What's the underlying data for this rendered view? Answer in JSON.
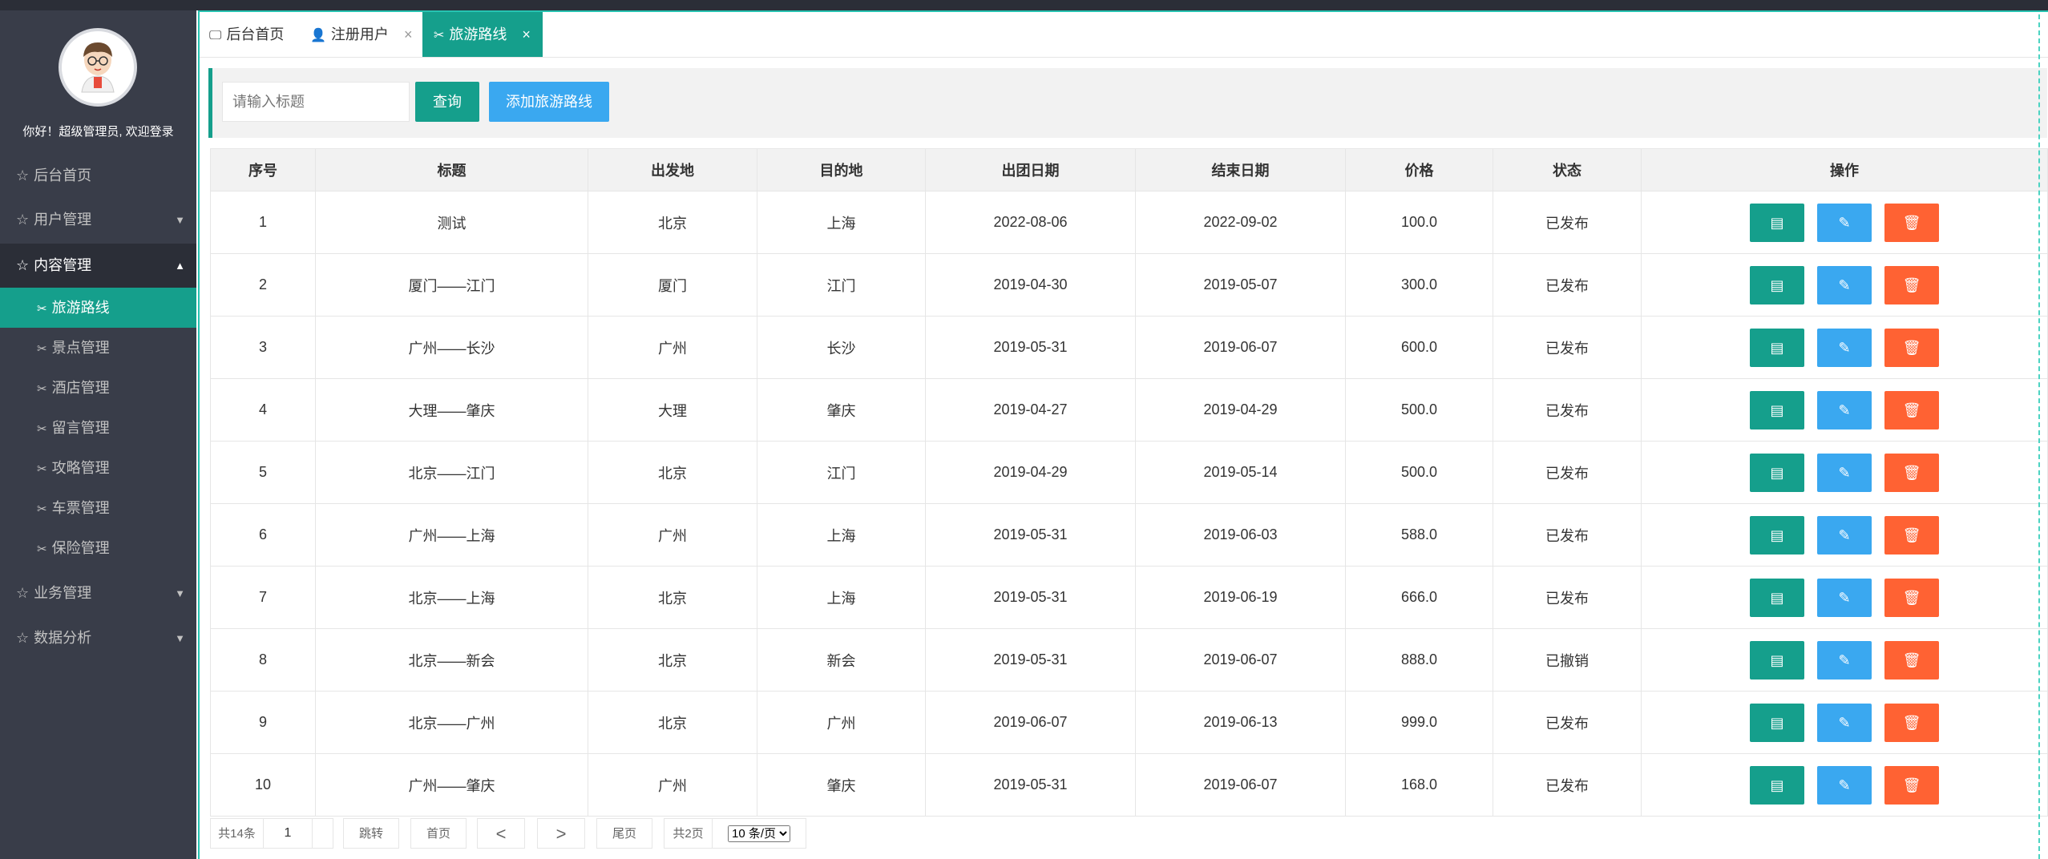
{
  "sidebar": {
    "welcome": "你好！超级管理员, 欢迎登录",
    "menu": [
      {
        "label": "后台首页"
      },
      {
        "label": "用户管理"
      },
      {
        "label": "内容管理"
      },
      {
        "label": "业务管理"
      },
      {
        "label": "数据分析"
      }
    ],
    "submenu": [
      {
        "label": "旅游路线"
      },
      {
        "label": "景点管理"
      },
      {
        "label": "酒店管理"
      },
      {
        "label": "留言管理"
      },
      {
        "label": "攻略管理"
      },
      {
        "label": "车票管理"
      },
      {
        "label": "保险管理"
      }
    ]
  },
  "tabs": [
    {
      "label": "后台首页"
    },
    {
      "label": "注册用户"
    },
    {
      "label": "旅游路线"
    }
  ],
  "search": {
    "placeholder": "请输入标题",
    "query_label": "查询",
    "add_label": "添加旅游路线"
  },
  "table": {
    "headers": [
      "序号",
      "标题",
      "出发地",
      "目的地",
      "出团日期",
      "结束日期",
      "价格",
      "状态",
      "操作"
    ],
    "rows": [
      [
        "1",
        "测试",
        "北京",
        "上海",
        "2022-08-06",
        "2022-09-02",
        "100.0",
        "已发布"
      ],
      [
        "2",
        "厦门——江门",
        "厦门",
        "江门",
        "2019-04-30",
        "2019-05-07",
        "300.0",
        "已发布"
      ],
      [
        "3",
        "广州——长沙",
        "广州",
        "长沙",
        "2019-05-31",
        "2019-06-07",
        "600.0",
        "已发布"
      ],
      [
        "4",
        "大理——肇庆",
        "大理",
        "肇庆",
        "2019-04-27",
        "2019-04-29",
        "500.0",
        "已发布"
      ],
      [
        "5",
        "北京——江门",
        "北京",
        "江门",
        "2019-04-29",
        "2019-05-14",
        "500.0",
        "已发布"
      ],
      [
        "6",
        "广州——上海",
        "广州",
        "上海",
        "2019-05-31",
        "2019-06-03",
        "588.0",
        "已发布"
      ],
      [
        "7",
        "北京——上海",
        "北京",
        "上海",
        "2019-05-31",
        "2019-06-19",
        "666.0",
        "已发布"
      ],
      [
        "8",
        "北京——新会",
        "北京",
        "新会",
        "2019-05-31",
        "2019-06-07",
        "888.0",
        "已撤销"
      ],
      [
        "9",
        "北京——广州",
        "北京",
        "广州",
        "2019-06-07",
        "2019-06-13",
        "999.0",
        "已发布"
      ],
      [
        "10",
        "广州——肇庆",
        "广州",
        "肇庆",
        "2019-05-31",
        "2019-06-07",
        "168.0",
        "已发布"
      ]
    ]
  },
  "pager": {
    "total": "共14条",
    "page_value": "1",
    "jump": "跳转",
    "first": "首页",
    "prev": "<",
    "next": ">",
    "last": "尾页",
    "pages": "共2页",
    "page_size": "10 条/页"
  },
  "colors": {
    "accent": "#159f8c",
    "blue": "#3aa8f0",
    "danger": "#ff6233",
    "sidebar": "#393d49"
  }
}
